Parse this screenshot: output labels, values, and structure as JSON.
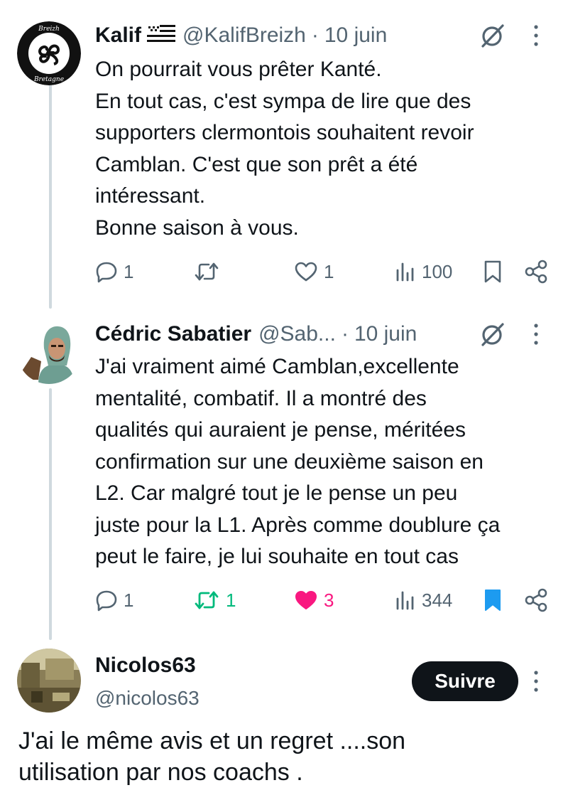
{
  "tweets": [
    {
      "name": "Kalif",
      "flag_icon": "breton-flag-icon",
      "handle": "@KalifBreizh",
      "separator": "·",
      "date": "10 juin",
      "avatar_text_top": "Breizh",
      "avatar_text_bottom": "Bretagne",
      "body_lines": [
        "On pourrait vous prêter Kanté.",
        "En tout cas, c'est sympa de lire que des",
        "supporters clermontois souhaitent revoir",
        "Camblan. C'est que son prêt a été",
        "intéressant.",
        "Bonne saison à vous."
      ],
      "replies": "1",
      "retweets": "",
      "likes": "1",
      "views": "100"
    },
    {
      "name": "Cédric Sabatier",
      "handle": "@Sab...",
      "separator": "·",
      "date": "10 juin",
      "body_lines": [
        "J'ai vraiment aimé Camblan,excellente",
        "mentalité, combatif. Il a montré des",
        "qualités qui auraient je pense, méritées",
        "confirmation sur une deuxième saison en",
        "L2. Car malgré tout je le pense un peu",
        "juste pour la L1. Après comme doublure ça",
        "peut le faire, je lui souhaite en tout cas"
      ],
      "replies": "1",
      "retweets": "1",
      "likes": "3",
      "views": "344"
    }
  ],
  "focused": {
    "name": "Nicolos63",
    "handle": "@nicolos63",
    "follow_label": "Suivre",
    "body_lines": [
      "J'ai le même avis et un regret ....son",
      "utilisation par nos coachs ."
    ]
  },
  "colors": {
    "text": "#0f1419",
    "muted": "#536471",
    "retweet_green": "#00ba7c",
    "like_pink": "#f91880",
    "bookmark_blue": "#1d9bf0",
    "thread_line": "#cfd9de"
  }
}
